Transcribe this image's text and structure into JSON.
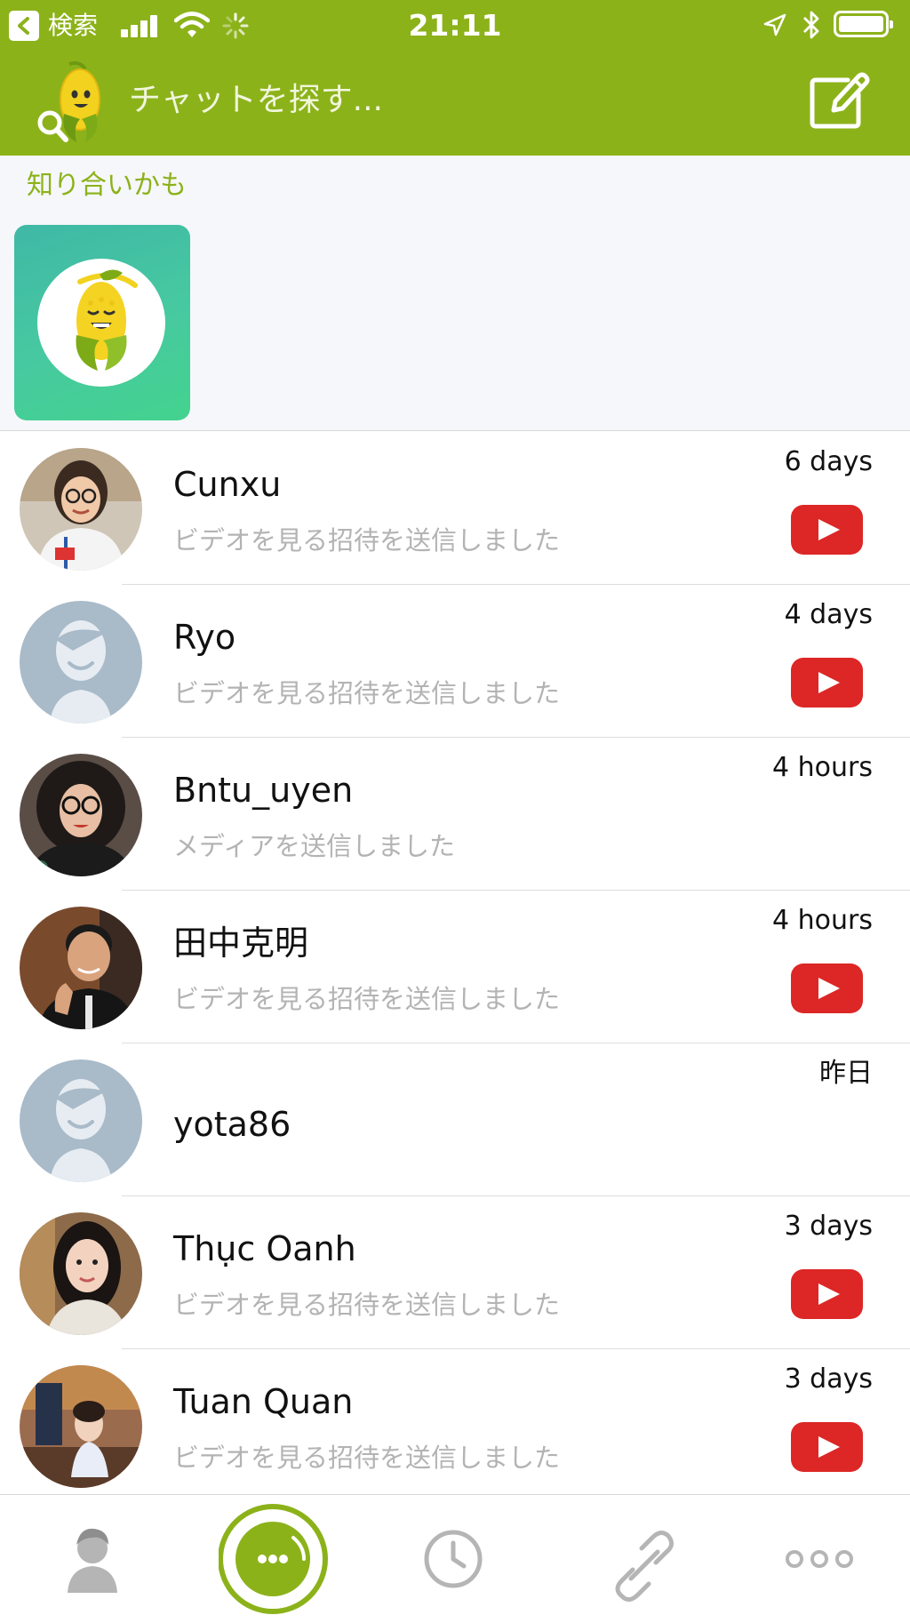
{
  "status_bar": {
    "back_label": "検索",
    "time": "21:11"
  },
  "header": {
    "search_placeholder": "チャットを探す...",
    "brand_color": "#8cb21a"
  },
  "suggestions": {
    "title": "知り合いかも"
  },
  "chats": [
    {
      "name": "Cunxu",
      "message": "ビデオを見る招待を送信しました",
      "time": "6 days",
      "video_icon": true,
      "avatar": "photo-woman-glasses"
    },
    {
      "name": "Ryo",
      "message": "ビデオを見る招待を送信しました",
      "time": "4 days",
      "video_icon": true,
      "avatar": "default-avatar"
    },
    {
      "name": "Bntu_uyen",
      "message": "メディアを送信しました",
      "time": "4 hours",
      "video_icon": false,
      "avatar": "photo-woman-glasses-dark"
    },
    {
      "name": "田中克明",
      "message": "ビデオを見る招待を送信しました",
      "time": "4 hours",
      "video_icon": true,
      "avatar": "photo-man-thumbs-up"
    },
    {
      "name": "yota86",
      "message": "",
      "time": "昨日",
      "video_icon": false,
      "avatar": "default-avatar"
    },
    {
      "name": "Thục Oanh",
      "message": "ビデオを見る招待を送信しました",
      "time": "3 days",
      "video_icon": true,
      "avatar": "photo-woman-selfie"
    },
    {
      "name": "Tuan Quan",
      "message": "ビデオを見る招待を送信しました",
      "time": "3 days",
      "video_icon": true,
      "avatar": "photo-child"
    }
  ],
  "tabbar": {
    "tabs": [
      {
        "icon": "person-icon",
        "active": false
      },
      {
        "icon": "chat-bubble-icon",
        "active": true
      },
      {
        "icon": "clock-icon",
        "active": false
      },
      {
        "icon": "link-icon",
        "active": false
      },
      {
        "icon": "more-dots-icon",
        "active": false
      }
    ]
  },
  "colors": {
    "accent": "#8cb21a",
    "youtube_red": "#dc2726",
    "secondary_text": "#b3b3b3"
  }
}
